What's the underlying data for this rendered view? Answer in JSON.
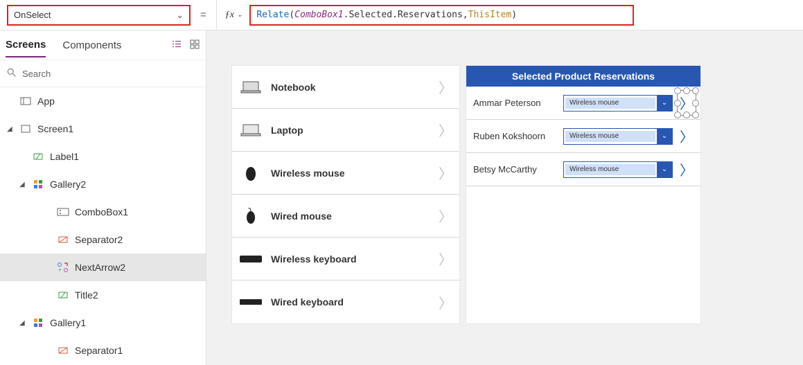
{
  "property_selector": {
    "value": "OnSelect"
  },
  "formula": {
    "fn": "Relate",
    "open": "( ",
    "obj": "ComboBox1",
    "mid": ".Selected.Reservations, ",
    "ctx": "ThisItem",
    "close": " )"
  },
  "left_tabs": {
    "screens": "Screens",
    "components": "Components"
  },
  "search": {
    "placeholder": "Search"
  },
  "tree": {
    "app": "App",
    "screen1": "Screen1",
    "label1": "Label1",
    "gallery2": "Gallery2",
    "combobox1": "ComboBox1",
    "separator2": "Separator2",
    "nextarrow2": "NextArrow2",
    "title2": "Title2",
    "gallery1": "Gallery1",
    "separator1": "Separator1"
  },
  "products": [
    {
      "label": "Notebook"
    },
    {
      "label": "Laptop"
    },
    {
      "label": "Wireless mouse"
    },
    {
      "label": "Wired mouse"
    },
    {
      "label": "Wireless keyboard"
    },
    {
      "label": "Wired keyboard"
    }
  ],
  "reservations_header": "Selected Product Reservations",
  "reservations": [
    {
      "name": "Ammar Peterson",
      "combo": "Wireless mouse"
    },
    {
      "name": "Ruben Kokshoorn",
      "combo": "Wireless mouse"
    },
    {
      "name": "Betsy McCarthy",
      "combo": "Wireless mouse"
    }
  ]
}
